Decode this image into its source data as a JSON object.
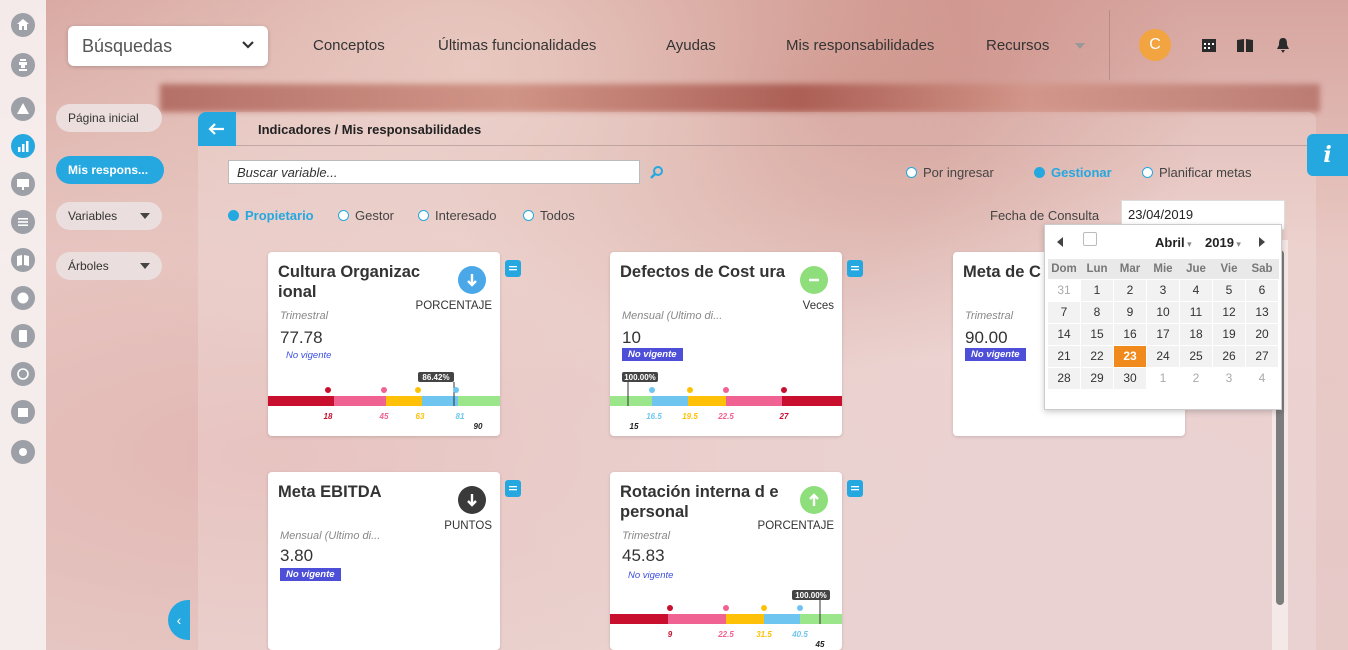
{
  "topbar": {
    "search_label": "Búsquedas",
    "nav": [
      "Conceptos",
      "Últimas funcionalidades",
      "Ayudas",
      "Mis responsabilidades",
      "Recursos"
    ],
    "avatar_initial": "C"
  },
  "sidemenu": {
    "items": [
      {
        "label": "Página inicial"
      },
      {
        "label": "Mis respons..."
      },
      {
        "label": "Variables"
      },
      {
        "label": "Árboles"
      }
    ]
  },
  "panel": {
    "title": "Indicadores / Mis responsabilidades",
    "search_placeholder": "Buscar variable...",
    "modes": [
      "Por ingresar",
      "Gestionar",
      "Planificar metas"
    ],
    "active_mode": "Gestionar",
    "filters": [
      "Propietario",
      "Gestor",
      "Interesado",
      "Todos"
    ],
    "active_filter": "Propietario",
    "fecha_label": "Fecha de Consulta",
    "fecha_value": "23/04/2019"
  },
  "calendar": {
    "month": "Abril",
    "year": "2019",
    "weekdays": [
      "Dom",
      "Lun",
      "Mar",
      "Mie",
      "Jue",
      "Vie",
      "Sab"
    ],
    "weeks": [
      [
        "31",
        "1",
        "2",
        "3",
        "4",
        "5",
        "6"
      ],
      [
        "7",
        "8",
        "9",
        "10",
        "11",
        "12",
        "13"
      ],
      [
        "14",
        "15",
        "16",
        "17",
        "18",
        "19",
        "20"
      ],
      [
        "21",
        "22",
        "23",
        "24",
        "25",
        "26",
        "27"
      ],
      [
        "28",
        "29",
        "30",
        "1",
        "2",
        "3",
        "4"
      ]
    ],
    "selected": "23"
  },
  "cards": [
    {
      "title": "Cultura Organizac ional",
      "unit": "PORCENTAJE",
      "period": "Trimestral",
      "value": "77.78",
      "status": "No vigente",
      "status_style": "text",
      "trend": "down",
      "trend_color": "#4aa8e8",
      "pct_badge": "86.42%",
      "thresholds": [
        "18",
        "45",
        "63",
        "81",
        "90"
      ]
    },
    {
      "title": "Defectos de Cost ura",
      "unit": "Veces",
      "period": "Mensual (Ultimo di...",
      "value": "10",
      "status": "No vigente",
      "status_style": "badge",
      "trend": "neutral",
      "trend_color": "#8fde7c",
      "pct_badge": "100.00%",
      "thresholds": [
        "15",
        "16.5",
        "19.5",
        "22.5",
        "27"
      ]
    },
    {
      "title": "Meta de C rganizaci",
      "unit": "",
      "period": "Trimestral",
      "value": "90.00",
      "status": "No vigente",
      "status_style": "badge"
    },
    {
      "title": "Meta EBITDA",
      "unit": "PUNTOS",
      "period": "Mensual (Ultimo di...",
      "value": "3.80",
      "status": "No vigente",
      "status_style": "badge",
      "trend": "down",
      "trend_color": "#3a3a3a"
    },
    {
      "title": "Rotación interna d e personal",
      "unit": "PORCENTAJE",
      "period": "Trimestral",
      "value": "45.83",
      "status": "No vigente",
      "status_style": "text",
      "trend": "up",
      "trend_color": "#8fde7c",
      "pct_badge": "100.00%",
      "thresholds": [
        "9",
        "22.5",
        "31.5",
        "40.5",
        "45"
      ]
    }
  ],
  "colors": {
    "accent": "#25a8e0",
    "scale_red": "#c8102e",
    "scale_pink": "#f06292",
    "scale_yellow": "#ffc107",
    "scale_blue": "#6ec6f0",
    "scale_green": "#9be58a"
  },
  "icons": [
    "home-icon",
    "trophy-icon",
    "pyramid-icon",
    "chart-icon",
    "presentation-icon",
    "list-icon",
    "book-icon",
    "clock-icon",
    "document-icon",
    "cycle-icon",
    "calendar-icon",
    "gear-icon",
    "calendar-icon",
    "library-icon",
    "bell-icon",
    "info-icon"
  ]
}
